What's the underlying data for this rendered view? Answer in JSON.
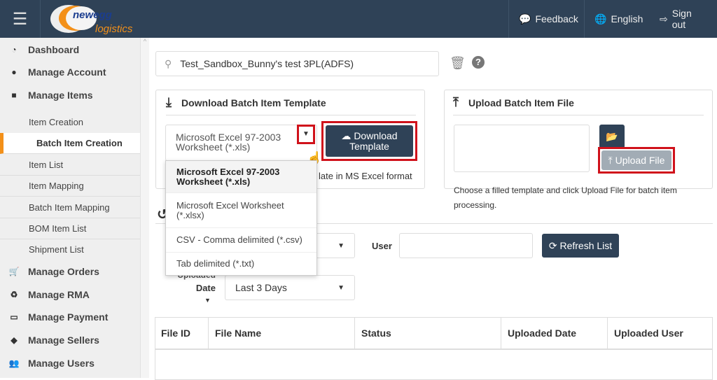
{
  "header": {
    "logo_text": "newegg",
    "logo_sub": "logistics",
    "feedback": "Feedback",
    "language": "English",
    "signout": "Sign out"
  },
  "sidebar": {
    "items": [
      {
        "label": "Dashboard",
        "icon": "dashboard-icon"
      },
      {
        "label": "Manage Account",
        "icon": "user-icon"
      },
      {
        "label": "Manage Items",
        "icon": "archive-icon"
      },
      {
        "label": "Manage Orders",
        "icon": "cart-icon"
      },
      {
        "label": "Manage RMA",
        "icon": "recycle-icon"
      },
      {
        "label": "Manage Payment",
        "icon": "credit-card-icon"
      },
      {
        "label": "Manage Sellers",
        "icon": "tags-icon"
      },
      {
        "label": "Manage Users",
        "icon": "users-icon"
      }
    ],
    "sub_items": [
      "Item Creation",
      "Batch Item Creation",
      "Item List",
      "Item Mapping",
      "Batch Item Mapping",
      "BOM Item List",
      "Shipment List"
    ],
    "active": "Batch Item Creation"
  },
  "search": {
    "value": "Test_Sandbox_Bunny's test 3PL(ADFS)"
  },
  "download": {
    "title": "Download Batch Item Template",
    "selected": "Microsoft Excel 97-2003 Worksheet (*.xls)",
    "button": "Download Template",
    "hint_visible": "late in MS Excel format",
    "options": [
      "Microsoft Excel 97-2003 Worksheet (*.xls)",
      "Microsoft Excel Worksheet (*.xlsx)",
      "CSV - Comma delimited (*.csv)",
      "Tab delimited (*.txt)"
    ]
  },
  "upload": {
    "title": "Upload Batch Item File",
    "button": "Upload File",
    "hint": "Choose a filled template and click Upload File for batch item processing."
  },
  "filters": {
    "user_label": "User",
    "user_value": "",
    "refresh": "Refresh List",
    "date_label_top": "Uploaded",
    "date_label": "Date",
    "date_value": "Last 3 Days"
  },
  "table": {
    "columns": [
      "File ID",
      "File Name",
      "Status",
      "Uploaded Date",
      "Uploaded User"
    ]
  },
  "colors": {
    "header": "#2f4257",
    "accent": "#f39019",
    "highlight": "#d0121b"
  }
}
